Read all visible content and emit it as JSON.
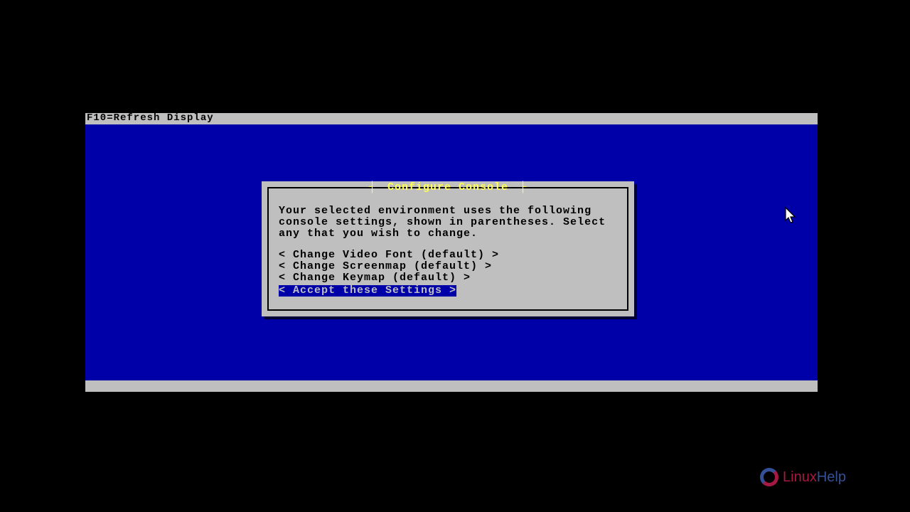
{
  "topbar": {
    "hint": "F10=Refresh Display"
  },
  "dialog": {
    "title": "Configure Console",
    "body": "Your selected environment uses the following console settings, shown in parentheses. Select any that you wish to change.",
    "options": {
      "video_font": "< Change Video Font (default) >",
      "screenmap": "< Change Screenmap (default) >",
      "keymap": "< Change Keymap (default) >",
      "accept": "< Accept these Settings >"
    }
  },
  "branding": {
    "name1": "Linux",
    "name2": "Help"
  }
}
